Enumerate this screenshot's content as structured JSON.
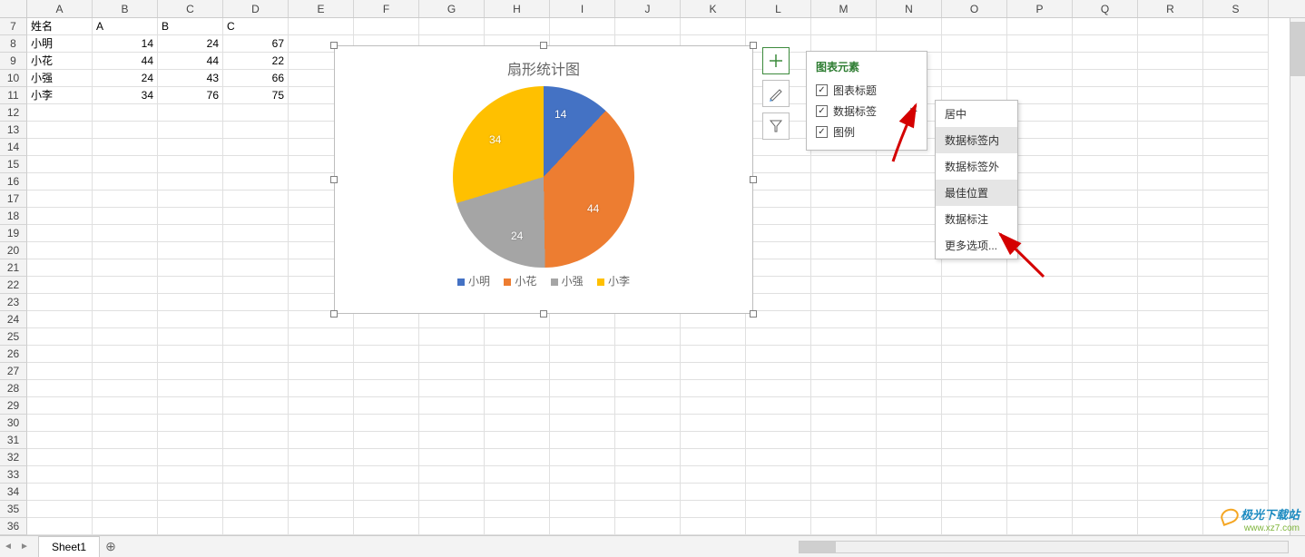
{
  "columns": [
    "A",
    "B",
    "C",
    "D",
    "E",
    "F",
    "G",
    "H",
    "I",
    "J",
    "K",
    "L",
    "M",
    "N",
    "O",
    "P",
    "Q",
    "R",
    "S"
  ],
  "startRow": 7,
  "headerRow": {
    "A": "姓名",
    "B": "A",
    "C": "B",
    "D": "C"
  },
  "dataRows": [
    {
      "A": "小明",
      "B": "14",
      "C": "24",
      "D": "67"
    },
    {
      "A": "小花",
      "B": "44",
      "C": "44",
      "D": "22"
    },
    {
      "A": "小强",
      "B": "24",
      "C": "43",
      "D": "66"
    },
    {
      "A": "小李",
      "B": "34",
      "C": "76",
      "D": "75"
    }
  ],
  "emptyRowsTo": 36,
  "chart_data": {
    "type": "pie",
    "title": "扇形统计图",
    "series": [
      {
        "name": "小明",
        "value": 14,
        "color": "#4472C4"
      },
      {
        "name": "小花",
        "value": 44,
        "color": "#ED7D31"
      },
      {
        "name": "小强",
        "value": 24,
        "color": "#A5A5A5"
      },
      {
        "name": "小李",
        "value": 34,
        "color": "#FFC000"
      }
    ],
    "data_labels": [
      "14",
      "44",
      "24",
      "34"
    ]
  },
  "sideButtons": {
    "elements_tooltip": "图表元素",
    "styles_tooltip": "图表样式",
    "filter_tooltip": "图表筛选器"
  },
  "chartElementsPanel": {
    "title": "图表元素",
    "items": [
      {
        "label": "图表标题",
        "checked": true,
        "hasSub": false
      },
      {
        "label": "数据标签",
        "checked": true,
        "hasSub": true
      },
      {
        "label": "图例",
        "checked": true,
        "hasSub": false
      }
    ]
  },
  "dataLabelSubmenu": {
    "items": [
      {
        "label": "居中",
        "selected": false
      },
      {
        "label": "数据标签内",
        "selected": true
      },
      {
        "label": "数据标签外",
        "selected": false
      },
      {
        "label": "最佳位置",
        "selected": true
      },
      {
        "label": "数据标注",
        "selected": false
      },
      {
        "label": "更多选项...",
        "selected": false
      }
    ]
  },
  "sheetTab": "Sheet1",
  "watermark": {
    "brand": "极光下载站",
    "url": "www.xz7.com"
  }
}
